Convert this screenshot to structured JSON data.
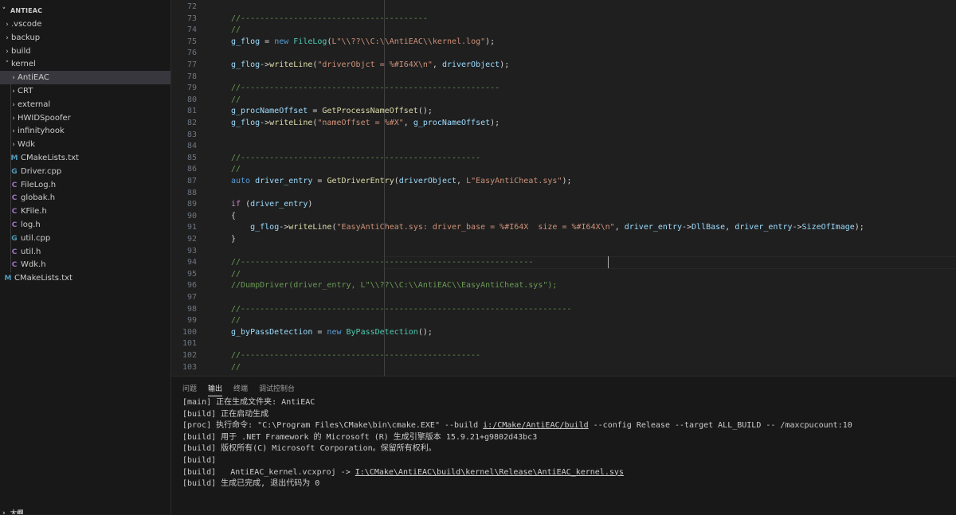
{
  "explorer": {
    "root_label": "ANTIEAC",
    "items": [
      {
        "label": ".vscode",
        "kind": "folder",
        "open": false
      },
      {
        "label": "backup",
        "kind": "folder",
        "open": false
      },
      {
        "label": "build",
        "kind": "folder",
        "open": false
      },
      {
        "label": "kernel",
        "kind": "folder",
        "open": true
      },
      {
        "label": "AntiEAC",
        "kind": "folder",
        "open": false
      },
      {
        "label": "CRT",
        "kind": "folder",
        "open": false
      },
      {
        "label": "external",
        "kind": "folder",
        "open": false
      },
      {
        "label": "HWIDSpoofer",
        "kind": "folder",
        "open": false
      },
      {
        "label": "infinityhook",
        "kind": "folder",
        "open": false
      },
      {
        "label": "Wdk",
        "kind": "folder",
        "open": false
      },
      {
        "label": "CMakeLists.txt",
        "kind": "cmake"
      },
      {
        "label": "Driver.cpp",
        "kind": "cpp"
      },
      {
        "label": "FileLog.h",
        "kind": "c"
      },
      {
        "label": "globak.h",
        "kind": "c"
      },
      {
        "label": "KFile.h",
        "kind": "c"
      },
      {
        "label": "log.h",
        "kind": "c"
      },
      {
        "label": "util.cpp",
        "kind": "cpp"
      },
      {
        "label": "util.h",
        "kind": "c"
      },
      {
        "label": "Wdk.h",
        "kind": "c"
      },
      {
        "label": "CMakeLists.txt",
        "kind": "cmake"
      }
    ],
    "outline_label": "大纲"
  },
  "editor": {
    "lines": [
      {
        "n": "72",
        "tokens": []
      },
      {
        "n": "73",
        "tokens": [
          {
            "c": "cmt",
            "t": "//---------------------------------------"
          }
        ]
      },
      {
        "n": "74",
        "tokens": [
          {
            "c": "cmt",
            "t": "//"
          }
        ]
      },
      {
        "n": "75",
        "tokens": [
          {
            "c": "var",
            "t": "g_flog"
          },
          {
            "c": "plain",
            "t": " = "
          },
          {
            "c": "kw",
            "t": "new"
          },
          {
            "c": "plain",
            "t": " "
          },
          {
            "c": "type",
            "t": "FileLog"
          },
          {
            "c": "plain",
            "t": "("
          },
          {
            "c": "str",
            "t": "L\"\\\\??\\\\C:\\\\AntiEAC\\\\kernel.log\""
          },
          {
            "c": "plain",
            "t": ");"
          }
        ]
      },
      {
        "n": "76",
        "tokens": []
      },
      {
        "n": "77",
        "tokens": [
          {
            "c": "var",
            "t": "g_flog"
          },
          {
            "c": "plain",
            "t": "->"
          },
          {
            "c": "fn",
            "t": "writeLine"
          },
          {
            "c": "plain",
            "t": "("
          },
          {
            "c": "str",
            "t": "\"driverObjct = %#I64X\\n\""
          },
          {
            "c": "plain",
            "t": ", "
          },
          {
            "c": "var",
            "t": "driverObject"
          },
          {
            "c": "plain",
            "t": ");"
          }
        ]
      },
      {
        "n": "78",
        "tokens": []
      },
      {
        "n": "79",
        "tokens": [
          {
            "c": "cmt",
            "t": "//------------------------------------------------------"
          }
        ]
      },
      {
        "n": "80",
        "tokens": [
          {
            "c": "cmt",
            "t": "//"
          }
        ]
      },
      {
        "n": "81",
        "tokens": [
          {
            "c": "var",
            "t": "g_procNameOffset"
          },
          {
            "c": "plain",
            "t": " = "
          },
          {
            "c": "fn",
            "t": "GetProcessNameOffset"
          },
          {
            "c": "plain",
            "t": "();"
          }
        ]
      },
      {
        "n": "82",
        "tokens": [
          {
            "c": "var",
            "t": "g_flog"
          },
          {
            "c": "plain",
            "t": "->"
          },
          {
            "c": "fn",
            "t": "writeLine"
          },
          {
            "c": "plain",
            "t": "("
          },
          {
            "c": "str",
            "t": "\"nameOffset = %#X\""
          },
          {
            "c": "plain",
            "t": ", "
          },
          {
            "c": "var",
            "t": "g_procNameOffset"
          },
          {
            "c": "plain",
            "t": ");"
          }
        ]
      },
      {
        "n": "83",
        "tokens": []
      },
      {
        "n": "84",
        "tokens": []
      },
      {
        "n": "85",
        "tokens": [
          {
            "c": "cmt",
            "t": "//--------------------------------------------------"
          }
        ]
      },
      {
        "n": "86",
        "tokens": [
          {
            "c": "cmt",
            "t": "//"
          }
        ]
      },
      {
        "n": "87",
        "tokens": [
          {
            "c": "kw",
            "t": "auto"
          },
          {
            "c": "plain",
            "t": " "
          },
          {
            "c": "var",
            "t": "driver_entry"
          },
          {
            "c": "plain",
            "t": " = "
          },
          {
            "c": "fn",
            "t": "GetDriverEntry"
          },
          {
            "c": "plain",
            "t": "("
          },
          {
            "c": "var",
            "t": "driverObject"
          },
          {
            "c": "plain",
            "t": ", "
          },
          {
            "c": "str",
            "t": "L\"EasyAntiCheat.sys\""
          },
          {
            "c": "plain",
            "t": ");"
          }
        ]
      },
      {
        "n": "88",
        "tokens": []
      },
      {
        "n": "89",
        "tokens": [
          {
            "c": "ctl",
            "t": "if"
          },
          {
            "c": "plain",
            "t": " ("
          },
          {
            "c": "var",
            "t": "driver_entry"
          },
          {
            "c": "plain",
            "t": ")"
          }
        ]
      },
      {
        "n": "90",
        "tokens": [
          {
            "c": "plain",
            "t": "{"
          }
        ]
      },
      {
        "n": "91",
        "tokens": [
          {
            "c": "plain",
            "t": "    "
          },
          {
            "c": "var",
            "t": "g_flog"
          },
          {
            "c": "plain",
            "t": "->"
          },
          {
            "c": "fn",
            "t": "writeLine"
          },
          {
            "c": "plain",
            "t": "("
          },
          {
            "c": "str",
            "t": "\"EasyAntiCheat.sys: driver_base = %#I64X  size = %#I64X\\n\""
          },
          {
            "c": "plain",
            "t": ", "
          },
          {
            "c": "var",
            "t": "driver_entry"
          },
          {
            "c": "plain",
            "t": "->"
          },
          {
            "c": "var",
            "t": "DllBase"
          },
          {
            "c": "plain",
            "t": ", "
          },
          {
            "c": "var",
            "t": "driver_entry"
          },
          {
            "c": "plain",
            "t": "->"
          },
          {
            "c": "var",
            "t": "SizeOfImage"
          },
          {
            "c": "plain",
            "t": ");"
          }
        ]
      },
      {
        "n": "92",
        "tokens": [
          {
            "c": "plain",
            "t": "}"
          }
        ]
      },
      {
        "n": "93",
        "tokens": []
      },
      {
        "n": "94",
        "tokens": [
          {
            "c": "cmt",
            "t": "//-------------------------------------------------------------"
          }
        ]
      },
      {
        "n": "95",
        "tokens": [
          {
            "c": "cmt",
            "t": "//"
          }
        ]
      },
      {
        "n": "96",
        "tokens": [
          {
            "c": "cmt",
            "t": "//DumpDriver(driver_entry, L\"\\\\??\\\\C:\\\\AntiEAC\\\\EasyAntiCheat.sys\");"
          }
        ]
      },
      {
        "n": "97",
        "tokens": []
      },
      {
        "n": "98",
        "tokens": [
          {
            "c": "cmt",
            "t": "//---------------------------------------------------------------------"
          }
        ]
      },
      {
        "n": "99",
        "tokens": [
          {
            "c": "cmt",
            "t": "//"
          }
        ]
      },
      {
        "n": "100",
        "tokens": [
          {
            "c": "var",
            "t": "g_byPassDetection"
          },
          {
            "c": "plain",
            "t": " = "
          },
          {
            "c": "kw",
            "t": "new"
          },
          {
            "c": "plain",
            "t": " "
          },
          {
            "c": "type",
            "t": "ByPassDetection"
          },
          {
            "c": "plain",
            "t": "();"
          }
        ]
      },
      {
        "n": "101",
        "tokens": []
      },
      {
        "n": "102",
        "tokens": [
          {
            "c": "cmt",
            "t": "//--------------------------------------------------"
          }
        ]
      },
      {
        "n": "103",
        "tokens": [
          {
            "c": "cmt",
            "t": "//"
          }
        ]
      }
    ]
  },
  "panel": {
    "tabs": [
      "问题",
      "输出",
      "终端",
      "调试控制台"
    ],
    "active_tab": "输出",
    "output": [
      {
        "text": "[main] 正在生成文件夹: AntiEAC"
      },
      {
        "text": "[build] 正在启动生成"
      },
      {
        "pre": "[proc] 执行命令: \"C:\\Program Files\\CMake\\bin\\cmake.EXE\" --build ",
        "link": "i:/CMake/AntiEAC/build",
        "post": " --config Release --target ALL_BUILD -- /maxcpucount:10"
      },
      {
        "text": "[build] 用于 .NET Framework 的 Microsoft (R) 生成引擎版本 15.9.21+g9802d43bc3"
      },
      {
        "text": "[build] 版权所有(C) Microsoft Corporation。保留所有权利。"
      },
      {
        "text": "[build]"
      },
      {
        "pre": "[build]   AntiEAC_kernel.vcxproj -> ",
        "link": "I:\\CMake\\AntiEAC\\build\\kernel\\Release\\AntiEAC_kernel.sys",
        "post": ""
      },
      {
        "text": "[build] 生成已完成, 退出代码为 0"
      }
    ]
  },
  "colors": {
    "comment": "#6a9955",
    "variable": "#9cdcfe",
    "keyword": "#569cd6",
    "control": "#c586c0",
    "function": "#dcdcaa",
    "string": "#ce9178",
    "type": "#4ec9b0"
  }
}
